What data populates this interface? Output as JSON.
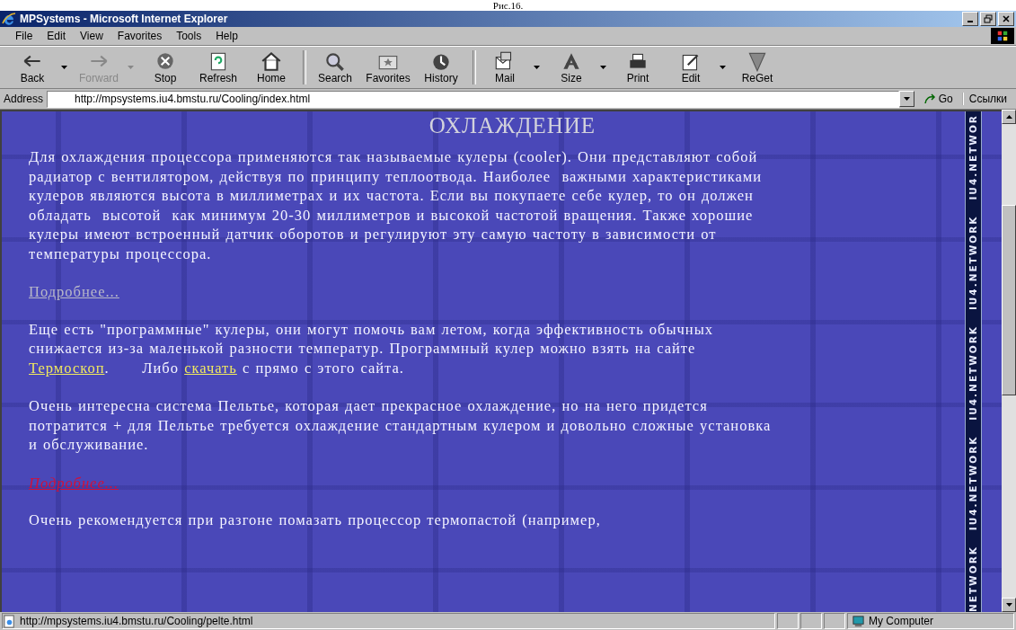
{
  "caption": "Рис.16.",
  "window": {
    "title": "MPSystems - Microsoft Internet Explorer"
  },
  "menu": [
    "File",
    "Edit",
    "View",
    "Favorites",
    "Tools",
    "Help"
  ],
  "toolbar": [
    {
      "label": "Back",
      "disabled": false,
      "dropdown": true
    },
    {
      "label": "Forward",
      "disabled": true,
      "dropdown": true
    },
    {
      "label": "Stop",
      "disabled": false,
      "dropdown": false
    },
    {
      "label": "Refresh",
      "disabled": false,
      "dropdown": false
    },
    {
      "label": "Home",
      "disabled": false,
      "dropdown": false
    },
    {
      "label": "Search",
      "disabled": false,
      "dropdown": false
    },
    {
      "label": "Favorites",
      "disabled": false,
      "dropdown": false
    },
    {
      "label": "History",
      "disabled": false,
      "dropdown": false
    },
    {
      "label": "Mail",
      "disabled": false,
      "dropdown": true
    },
    {
      "label": "Size",
      "disabled": false,
      "dropdown": true
    },
    {
      "label": "Print",
      "disabled": false,
      "dropdown": false
    },
    {
      "label": "Edit",
      "disabled": false,
      "dropdown": true
    },
    {
      "label": "ReGet",
      "disabled": false,
      "dropdown": false
    }
  ],
  "address": {
    "label": "Address",
    "value": "http://mpsystems.iu4.bmstu.ru/Cooling/index.html",
    "go": "Go",
    "links": "Ссылки"
  },
  "page": {
    "heading": "ОХЛАЖДЕНИЕ",
    "blocks": [
      {
        "kind": "text",
        "parts": [
          {
            "kind": "text",
            "text": "Для охлаждения процессора применяются так называемые кулеры (cooler). Они представляют собой радиатор с вентилятором, действуя по принципу теплоотвода. Наиболее  важными характеристиками кулеров являются высота в миллиметрах и их частота. Если вы покупаете себе кулер, то он должен обладать  высотой  как минимум 20-30 миллиметров и высокой частотой вращения. Также хорошие кулеры имеют встроенный датчик оборотов и регулируют эту самую частоту в зависимости от температуры процессора."
          }
        ]
      },
      {
        "kind": "link",
        "text": "Подробнее...",
        "hovered": false
      },
      {
        "kind": "text",
        "parts": [
          {
            "kind": "text",
            "text": "Еще есть \"программные\" кулеры, они могут помочь вам летом, когда эффективность обычных снижается из-за маленькой разности температур. Программный кулер можно взять на сайте "
          },
          {
            "kind": "link",
            "text": "Термоскоп"
          },
          {
            "kind": "text",
            "text": ".      Либо "
          },
          {
            "kind": "link",
            "text": "скачать"
          },
          {
            "kind": "text",
            "text": " с прямо с этого сайта."
          }
        ]
      },
      {
        "kind": "text",
        "parts": [
          {
            "kind": "text",
            "text": "Очень интересна система Пельтье, которая дает прекрасное охлаждение, но на него придется потратится + для Пельтье требуется охлаждение стандартным кулером и довольно сложные установка и обслуживание."
          }
        ]
      },
      {
        "kind": "link",
        "text": "Подробнее...",
        "hovered": true
      },
      {
        "kind": "text",
        "parts": [
          {
            "kind": "text",
            "text": "Очень рекомендуется при разгоне помазать процессор термопастой (например,"
          }
        ]
      }
    ],
    "banner": "NETWORK   IU4.NETWORK   IU4.NETWORK   IU4.NETWORK   IU4.NETWOR"
  },
  "status_bar": {
    "url": "http://mpsystems.iu4.bmstu.ru/Cooling/pelte.html",
    "zone": "My Computer"
  }
}
